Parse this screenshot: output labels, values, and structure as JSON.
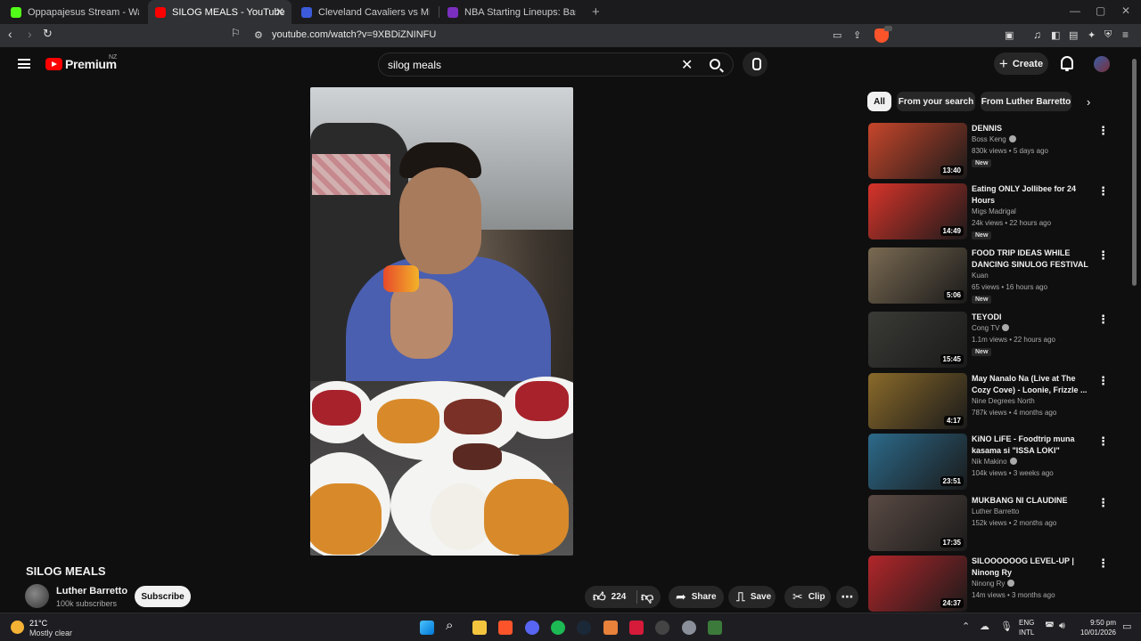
{
  "browser": {
    "tabs": [
      {
        "title": "Oppapajesus Stream - Watch Live on",
        "color": "#53fc18"
      },
      {
        "title": "SILOG MEALS - YouTube",
        "color": "#ff0000"
      },
      {
        "title": "Cleveland Cavaliers vs Minnesota Tim",
        "color": "#3b5bdb"
      },
      {
        "title": "NBA Starting Lineups: Basketball Dai",
        "color": "#7b2fbe"
      }
    ],
    "url": "youtube.com/watch?v=9XBDiZNINFU"
  },
  "header": {
    "logo_text": "Premium",
    "region": "NZ",
    "search_value": "silog meals",
    "create_label": "Create"
  },
  "video": {
    "title": "SILOG MEALS",
    "channel": "Luther Barretto",
    "subscribers": "100k subscribers",
    "subscribe_label": "Subscribe",
    "likes": "224",
    "share_label": "Share",
    "save_label": "Save",
    "clip_label": "Clip"
  },
  "chips": [
    "All",
    "From your search",
    "From Luther Barretto"
  ],
  "recommendations": [
    {
      "title": "DENNIS",
      "channel": "Boss Keng",
      "verified": true,
      "meta": "830k views • 5 days ago",
      "duration": "13:40",
      "new": "New",
      "thumb": "#c7462b"
    },
    {
      "title": "Eating ONLY Jollibee for 24 Hours",
      "channel": "Migs Madrigal",
      "verified": false,
      "meta": "24k views • 22 hours ago",
      "duration": "14:49",
      "new": "New",
      "thumb": "#d7342a"
    },
    {
      "title": "FOOD TRIP IDEAS WHILE DANCING SINULOG FESTIVAL ...",
      "channel": "Kuan",
      "verified": false,
      "meta": "65 views • 16 hours ago",
      "duration": "5:06",
      "new": "New",
      "thumb": "#7a6a52"
    },
    {
      "title": "TEYODI",
      "channel": "Cong TV",
      "verified": true,
      "meta": "1.1m views • 22 hours ago",
      "duration": "15:45",
      "new": "New",
      "thumb": "#3a3a36"
    },
    {
      "title": "May Nanalo Na (Live at The Cozy Cove) - Loonie, Frizzle ...",
      "channel": "Nine Degrees North",
      "verified": false,
      "meta": "787k views • 4 months ago",
      "duration": "4:17",
      "new": "",
      "thumb": "#8a6a2a"
    },
    {
      "title": "KiNO LiFE - Foodtrip muna kasama si \"ISSA LOKI\"",
      "channel": "Nik Makino",
      "verified": true,
      "meta": "104k views • 3 weeks ago",
      "duration": "23:51",
      "new": "",
      "thumb": "#2c6a8a"
    },
    {
      "title": "MUKBANG NI CLAUDINE",
      "channel": "Luther Barretto",
      "verified": false,
      "meta": "152k views • 2 months ago",
      "duration": "17:35",
      "new": "",
      "thumb": "#5a4a44"
    },
    {
      "title": "SILOOOOOOG LEVEL-UP | Ninong Ry",
      "channel": "Ninong Ry",
      "verified": true,
      "meta": "14m views • 3 months ago",
      "duration": "24:37",
      "new": "",
      "thumb": "#b2262a"
    }
  ],
  "taskbar": {
    "temp": "21°C",
    "condition": "Mostly clear",
    "lang1": "ENG",
    "lang2": "INTL",
    "time": "9:50 pm",
    "date": "10/01/2026"
  }
}
